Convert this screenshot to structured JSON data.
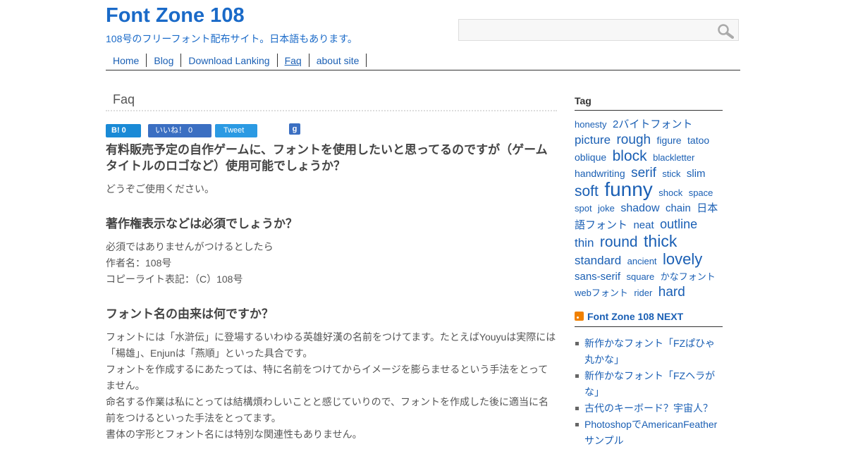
{
  "site": {
    "title": "Font Zone 108",
    "description": "108号のフリーフォント配布サイト。日本語もあります。"
  },
  "search": {
    "placeholder": ""
  },
  "nav": [
    "Home",
    "Blog",
    "Download Lanking",
    "Faq",
    "about site"
  ],
  "page_title": "Faq",
  "share": {
    "hatena": "B! 0",
    "facebook": "いいね！ 0",
    "twitter": "Tweet",
    "google": "g"
  },
  "faq": [
    {
      "q": "有料販売予定の自作ゲームに、フォントを使用したいと思ってるのですが（ゲームタイトルのロゴなど）使用可能でしょうか？",
      "a": [
        "どうぞご使用ください。"
      ]
    },
    {
      "q": "著作権表示などは必須でしょうか？",
      "a": [
        "必須ではありませんがつけるとしたら",
        "作者名：108号",
        "コピーライト表記：（C）108号"
      ]
    },
    {
      "q": "フォント名の由来は何ですか？",
      "a": [
        "フォントには「水滸伝」に登場するいわゆる英雄好漢の名前をつけてます。たとえばYouyuは実際には「楊雄」、Enjunは「燕順」といった具合です。",
        "フォントを作成するにあたっては、特に名前をつけてからイメージを膨らませるという手法をとってません。",
        "命名する作業は私にとっては結構煩わしいことと感じていりので、フォントを作成した後に適当に名前をつけるといった手法をとってます。",
        "書体の字形とフォント名には特別な関連性もありません。"
      ]
    }
  ],
  "sidebar": {
    "tag_heading": "Tag",
    "tags": [
      {
        "t": "honesty",
        "s": 13
      },
      {
        "t": "2バイトフォント",
        "s": 15
      },
      {
        "t": "picture",
        "s": 17
      },
      {
        "t": "rough",
        "s": 19
      },
      {
        "t": "figure",
        "s": 14
      },
      {
        "t": "tatoo",
        "s": 14
      },
      {
        "t": "oblique",
        "s": 14
      },
      {
        "t": "block",
        "s": 21
      },
      {
        "t": "blackletter",
        "s": 13
      },
      {
        "t": "handwriting",
        "s": 14
      },
      {
        "t": "serif",
        "s": 19
      },
      {
        "t": "stick",
        "s": 13
      },
      {
        "t": "slim",
        "s": 15
      },
      {
        "t": "soft",
        "s": 21
      },
      {
        "t": "funny",
        "s": 28
      },
      {
        "t": "shock",
        "s": 13
      },
      {
        "t": "space",
        "s": 13
      },
      {
        "t": "spot",
        "s": 13
      },
      {
        "t": "joke",
        "s": 13
      },
      {
        "t": "shadow",
        "s": 16
      },
      {
        "t": "chain",
        "s": 15
      },
      {
        "t": "日本語フォント",
        "s": 15
      },
      {
        "t": "neat",
        "s": 15
      },
      {
        "t": "outline",
        "s": 18
      },
      {
        "t": "thin",
        "s": 17
      },
      {
        "t": "round",
        "s": 21
      },
      {
        "t": "thick",
        "s": 23
      },
      {
        "t": "standard",
        "s": 17
      },
      {
        "t": "ancient",
        "s": 13
      },
      {
        "t": "lovely",
        "s": 22
      },
      {
        "t": "sans-serif",
        "s": 15
      },
      {
        "t": "square",
        "s": 13
      },
      {
        "t": "かなフォント",
        "s": 13
      },
      {
        "t": "webフォント",
        "s": 13
      },
      {
        "t": "rider",
        "s": 13
      },
      {
        "t": "hard",
        "s": 19
      }
    ],
    "rss_heading": "Font Zone 108 NEXT",
    "rss_items": [
      "新作かなフォント「FZぱひゃ丸かな」",
      "新作かなフォント「FZヘラがな」",
      "古代のキーボード？宇宙人？",
      "PhotoshopでAmericanFeatherサンプル"
    ]
  }
}
